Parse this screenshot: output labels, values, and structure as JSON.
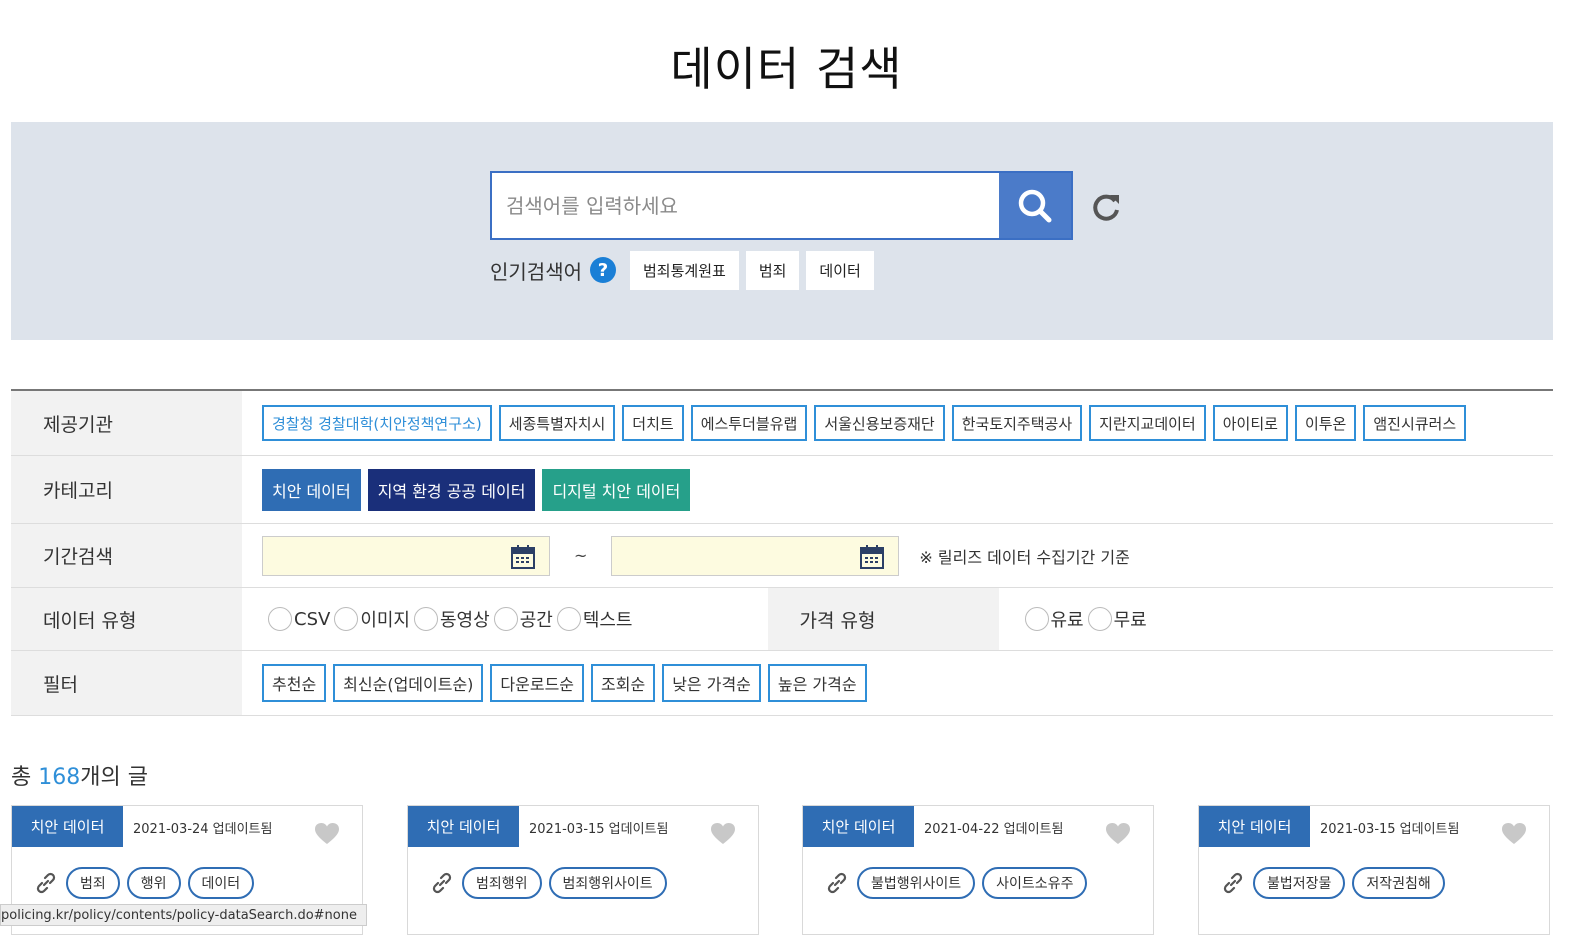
{
  "page": {
    "title": "데이터 검색"
  },
  "search": {
    "placeholder": "검색어를 입력하세요",
    "value": "",
    "popular_label": "인기검색어",
    "popular_keywords": [
      "범죄통계원표",
      "범죄",
      "데이터"
    ]
  },
  "filters": {
    "provider": {
      "label": "제공기관",
      "options": [
        "경찰청 경찰대학(치안정책연구소)",
        "세종특별자치시",
        "더치트",
        "에스투더블유랩",
        "서울신용보증재단",
        "한국토지주택공사",
        "지란지교데이터",
        "아이티로",
        "이투온",
        "앰진시큐러스"
      ]
    },
    "category": {
      "label": "카테고리",
      "options": [
        {
          "label": "치안 데이터",
          "color": "#2f6db4"
        },
        {
          "label": "지역 환경 공공 데이터",
          "color": "#1a2f7a"
        },
        {
          "label": "디지털 치안 데이터",
          "color": "#26a08a"
        }
      ]
    },
    "period": {
      "label": "기간검색",
      "separator": "~",
      "note": "※ 릴리즈 데이터 수집기간 기준"
    },
    "data_type": {
      "label": "데이터 유형",
      "options": [
        "CSV",
        "이미지",
        "동영상",
        "공간",
        "텍스트"
      ]
    },
    "price_type": {
      "label": "가격 유형",
      "options": [
        "유료",
        "무료"
      ]
    },
    "sort": {
      "label": "필터",
      "options": [
        "추천순",
        "최신순(업데이트순)",
        "다운로드순",
        "조회순",
        "낮은 가격순",
        "높은 가격순"
      ]
    }
  },
  "results": {
    "total_prefix": "총 ",
    "total_count": "168",
    "total_suffix": "개의 글",
    "cards": [
      {
        "tag": "치안 데이터",
        "date": "2021-03-24 업데이트됨",
        "keywords": [
          "범죄",
          "행위",
          "데이터"
        ]
      },
      {
        "tag": "치안 데이터",
        "date": "2021-03-15 업데이트됨",
        "keywords": [
          "범죄행위",
          "범죄행위사이트"
        ]
      },
      {
        "tag": "치안 데이터",
        "date": "2021-04-22 업데이트됨",
        "keywords": [
          "불법행위사이트",
          "사이트소유주"
        ]
      },
      {
        "tag": "치안 데이터",
        "date": "2021-03-15 업데이트됨",
        "keywords": [
          "불법저장물",
          "저작권침해"
        ]
      }
    ]
  },
  "statusbar": {
    "url": "policing.kr/policy/contents/policy-dataSearch.do#none"
  },
  "colors": {
    "accent": "#2f8fd8",
    "search_button": "#4b7bc9",
    "band": "#dde3eb"
  }
}
